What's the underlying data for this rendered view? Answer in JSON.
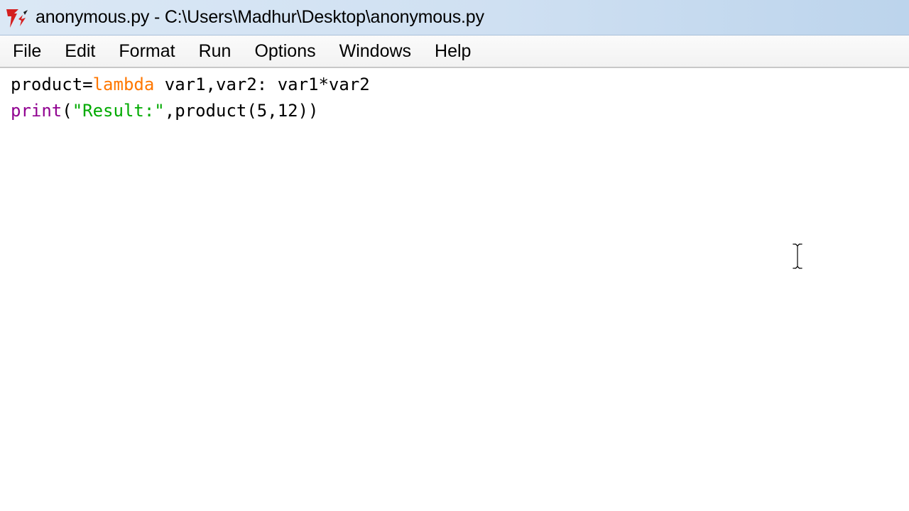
{
  "window": {
    "title": "anonymous.py - C:\\Users\\Madhur\\Desktop\\anonymous.py",
    "icon": "tk-feather-icon"
  },
  "menubar": {
    "items": [
      {
        "label": "File"
      },
      {
        "label": "Edit"
      },
      {
        "label": "Format"
      },
      {
        "label": "Run"
      },
      {
        "label": "Options"
      },
      {
        "label": "Windows"
      },
      {
        "label": "Help"
      }
    ]
  },
  "editor": {
    "lines": [
      {
        "tokens": [
          {
            "text": "product=",
            "kind": "plain"
          },
          {
            "text": "lambda",
            "kind": "keyword"
          },
          {
            "text": " var1,var2: var1*var2",
            "kind": "plain"
          }
        ]
      },
      {
        "tokens": [
          {
            "text": "print",
            "kind": "builtin"
          },
          {
            "text": "(",
            "kind": "plain"
          },
          {
            "text": "\"Result:\"",
            "kind": "string"
          },
          {
            "text": ",product(5,12))",
            "kind": "plain"
          }
        ]
      }
    ]
  },
  "colors": {
    "keyword": "#ff7700",
    "builtin": "#900090",
    "string": "#00aa00",
    "plain": "#000000"
  },
  "cursor": {
    "icon": "ibeam-cursor-icon"
  }
}
